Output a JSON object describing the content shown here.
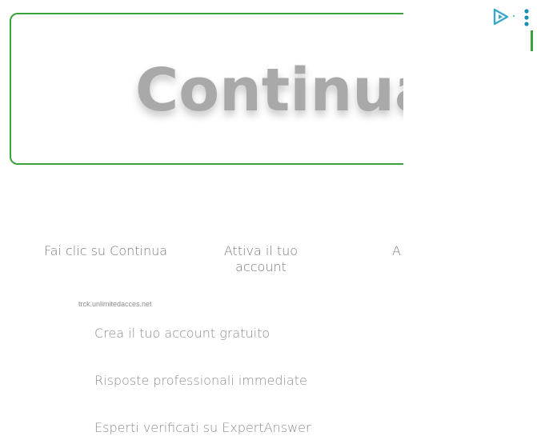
{
  "cta": {
    "label": "Continua"
  },
  "steps": [
    {
      "label": "Fai clic su Continua"
    },
    {
      "label": "Attiva il tuo account"
    },
    {
      "label": "A"
    }
  ],
  "domain_text": "trck.unlimitedacces.net",
  "features": [
    {
      "label": "Crea il tuo account gratuito"
    },
    {
      "label": "Risposte professionali immediate"
    },
    {
      "label": "Esperti verificati su ExpertAnswer"
    }
  ],
  "controls": {
    "adchoices_icon": "adchoices-icon",
    "menu_icon": "more-vert-icon"
  },
  "colors": {
    "accent_green": "#3aa23a",
    "accent_blue": "#3aa6c9",
    "text_gray": "#7b7b7b",
    "cta_text": "#a9a9a9"
  }
}
